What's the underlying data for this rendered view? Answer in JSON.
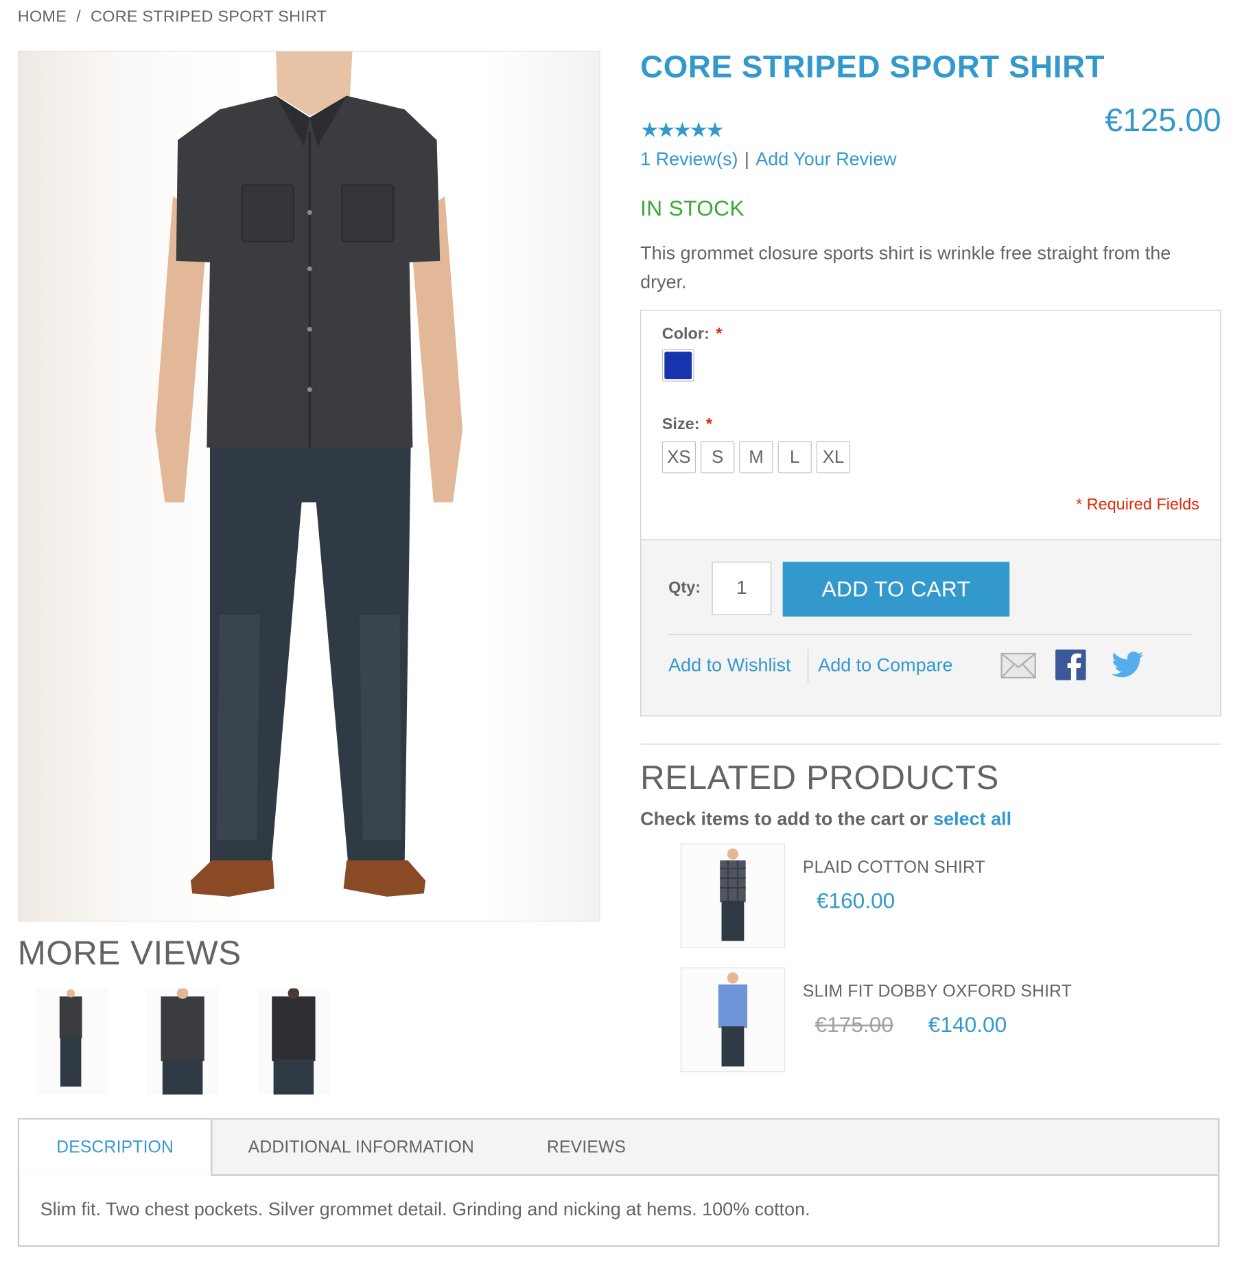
{
  "breadcrumb": {
    "home": "HOME",
    "separator": "/",
    "current": "CORE STRIPED SPORT SHIRT"
  },
  "product": {
    "name": "CORE STRIPED SPORT SHIRT",
    "price": "€125.00",
    "rating_stars": "★★★★★",
    "rating_value": 5,
    "rating_max": 5,
    "reviews_link": "1 Review(s)",
    "review_separator": "|",
    "add_review_link": "Add Your Review",
    "stock": "IN STOCK",
    "short_description": "This grommet closure sports shirt is wrinkle free straight from the dryer."
  },
  "options": {
    "color_label": "Color:",
    "required_star": "*",
    "color_swatch_hex": "#1733ae",
    "size_label": "Size:",
    "sizes": [
      "XS",
      "S",
      "M",
      "L",
      "XL"
    ],
    "required_note": "* Required Fields"
  },
  "cart": {
    "qty_label": "Qty:",
    "qty_value": "1",
    "add_to_cart": "ADD TO CART",
    "wishlist": "Add to Wishlist",
    "compare": "Add to Compare",
    "share_icons": [
      "email-icon",
      "facebook-icon",
      "twitter-icon"
    ]
  },
  "more_views": {
    "title": "MORE VIEWS",
    "thumbnails": 3
  },
  "related": {
    "title": "RELATED PRODUCTS",
    "check_text": "Check items to add to the cart or",
    "select_all": "select all",
    "items": [
      {
        "name": "PLAID COTTON SHIRT",
        "price": "€160.00"
      },
      {
        "name": "SLIM FIT DOBBY OXFORD SHIRT",
        "old_price": "€175.00",
        "price": "€140.00"
      }
    ]
  },
  "tabs": {
    "items": [
      "DESCRIPTION",
      "ADDITIONAL INFORMATION",
      "REVIEWS"
    ],
    "active": "DESCRIPTION",
    "content": "Slim fit. Two chest pockets. Silver grommet detail. Grinding and nicking at hems. 100% cotton."
  },
  "colors": {
    "accent": "#3399cc",
    "in_stock": "#3aaa35",
    "required": "#df280a",
    "text": "#636363"
  }
}
